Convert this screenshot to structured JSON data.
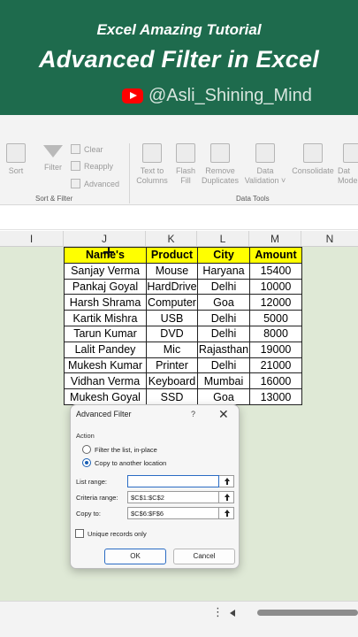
{
  "banner": {
    "subtitle": "Excel Amazing Tutorial",
    "title": "Advanced Filter in Excel",
    "channel": "@Asli_Shining_Mind",
    "colors": {
      "background": "#1e6b4d",
      "youtube": "#ff0000"
    }
  },
  "ribbon": {
    "sort_filter": {
      "sort": "Sort",
      "filter": "Filter",
      "clear": "Clear",
      "reapply": "Reapply",
      "advanced": "Advanced",
      "group_label": "Sort & Filter"
    },
    "data_tools": {
      "text_to_columns_1": "Text to",
      "text_to_columns_2": "Columns",
      "flash_fill_1": "Flash",
      "flash_fill_2": "Fill",
      "remove_duplicates_1": "Remove",
      "remove_duplicates_2": "Duplicates",
      "data_validation_1": "Data",
      "data_validation_2": "Validation ˅",
      "consolidate": "Consolidate",
      "data_model_1": "Dat",
      "data_model_2": "Mode",
      "group_label": "Data Tools"
    }
  },
  "columns": [
    "I",
    "J",
    "K",
    "L",
    "M",
    "N"
  ],
  "table": {
    "headers": [
      "Name's",
      "Product",
      "City",
      "Amount"
    ],
    "header_color": "#ffff00",
    "rows": [
      [
        "Sanjay Verma",
        "Mouse",
        "Haryana",
        "15400"
      ],
      [
        "Pankaj Goyal",
        "HardDrive",
        "Delhi",
        "10000"
      ],
      [
        "Harsh Shrama",
        "Computer",
        "Goa",
        "12000"
      ],
      [
        "Kartik Mishra",
        "USB",
        "Delhi",
        "5000"
      ],
      [
        "Tarun Kumar",
        "DVD",
        "Delhi",
        "8000"
      ],
      [
        "Lalit Pandey",
        "Mic",
        "Rajasthan",
        "19000"
      ],
      [
        "Mukesh Kumar",
        "Printer",
        "Delhi",
        "21000"
      ],
      [
        "Vidhan Verma",
        "Keyboard",
        "Mumbai",
        "16000"
      ],
      [
        "Mukesh Goyal",
        "SSD",
        "Goa",
        "13000"
      ]
    ]
  },
  "dialog": {
    "title": "Advanced Filter",
    "help": "?",
    "close": "✕",
    "action_label": "Action",
    "option_inplace": "Filter the list, in-place",
    "option_copy": "Copy to another location",
    "list_range_label": "List range:",
    "list_range_value": "",
    "criteria_range_label": "Criteria range:",
    "criteria_range_value": "$C$1:$C$2",
    "copy_to_label": "Copy to:",
    "copy_to_value": "$C$6:$F$6",
    "unique_label": "Unique records only",
    "ok": "OK",
    "cancel": "Cancel"
  },
  "statusbar": {
    "more": "⋮"
  }
}
